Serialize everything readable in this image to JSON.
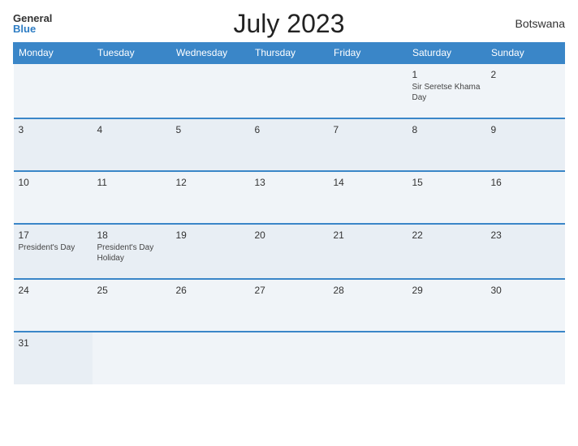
{
  "header": {
    "logo_general": "General",
    "logo_blue": "Blue",
    "title": "July 2023",
    "country": "Botswana"
  },
  "weekdays": [
    "Monday",
    "Tuesday",
    "Wednesday",
    "Thursday",
    "Friday",
    "Saturday",
    "Sunday"
  ],
  "weeks": [
    [
      {
        "day": "",
        "holiday": ""
      },
      {
        "day": "",
        "holiday": ""
      },
      {
        "day": "",
        "holiday": ""
      },
      {
        "day": "",
        "holiday": ""
      },
      {
        "day": "",
        "holiday": ""
      },
      {
        "day": "1",
        "holiday": "Sir Seretse Khama Day"
      },
      {
        "day": "2",
        "holiday": ""
      }
    ],
    [
      {
        "day": "3",
        "holiday": ""
      },
      {
        "day": "4",
        "holiday": ""
      },
      {
        "day": "5",
        "holiday": ""
      },
      {
        "day": "6",
        "holiday": ""
      },
      {
        "day": "7",
        "holiday": ""
      },
      {
        "day": "8",
        "holiday": ""
      },
      {
        "day": "9",
        "holiday": ""
      }
    ],
    [
      {
        "day": "10",
        "holiday": ""
      },
      {
        "day": "11",
        "holiday": ""
      },
      {
        "day": "12",
        "holiday": ""
      },
      {
        "day": "13",
        "holiday": ""
      },
      {
        "day": "14",
        "holiday": ""
      },
      {
        "day": "15",
        "holiday": ""
      },
      {
        "day": "16",
        "holiday": ""
      }
    ],
    [
      {
        "day": "17",
        "holiday": "President's Day"
      },
      {
        "day": "18",
        "holiday": "President's Day Holiday"
      },
      {
        "day": "19",
        "holiday": ""
      },
      {
        "day": "20",
        "holiday": ""
      },
      {
        "day": "21",
        "holiday": ""
      },
      {
        "day": "22",
        "holiday": ""
      },
      {
        "day": "23",
        "holiday": ""
      }
    ],
    [
      {
        "day": "24",
        "holiday": ""
      },
      {
        "day": "25",
        "holiday": ""
      },
      {
        "day": "26",
        "holiday": ""
      },
      {
        "day": "27",
        "holiday": ""
      },
      {
        "day": "28",
        "holiday": ""
      },
      {
        "day": "29",
        "holiday": ""
      },
      {
        "day": "30",
        "holiday": ""
      }
    ],
    [
      {
        "day": "31",
        "holiday": ""
      },
      {
        "day": "",
        "holiday": ""
      },
      {
        "day": "",
        "holiday": ""
      },
      {
        "day": "",
        "holiday": ""
      },
      {
        "day": "",
        "holiday": ""
      },
      {
        "day": "",
        "holiday": ""
      },
      {
        "day": "",
        "holiday": ""
      }
    ]
  ]
}
